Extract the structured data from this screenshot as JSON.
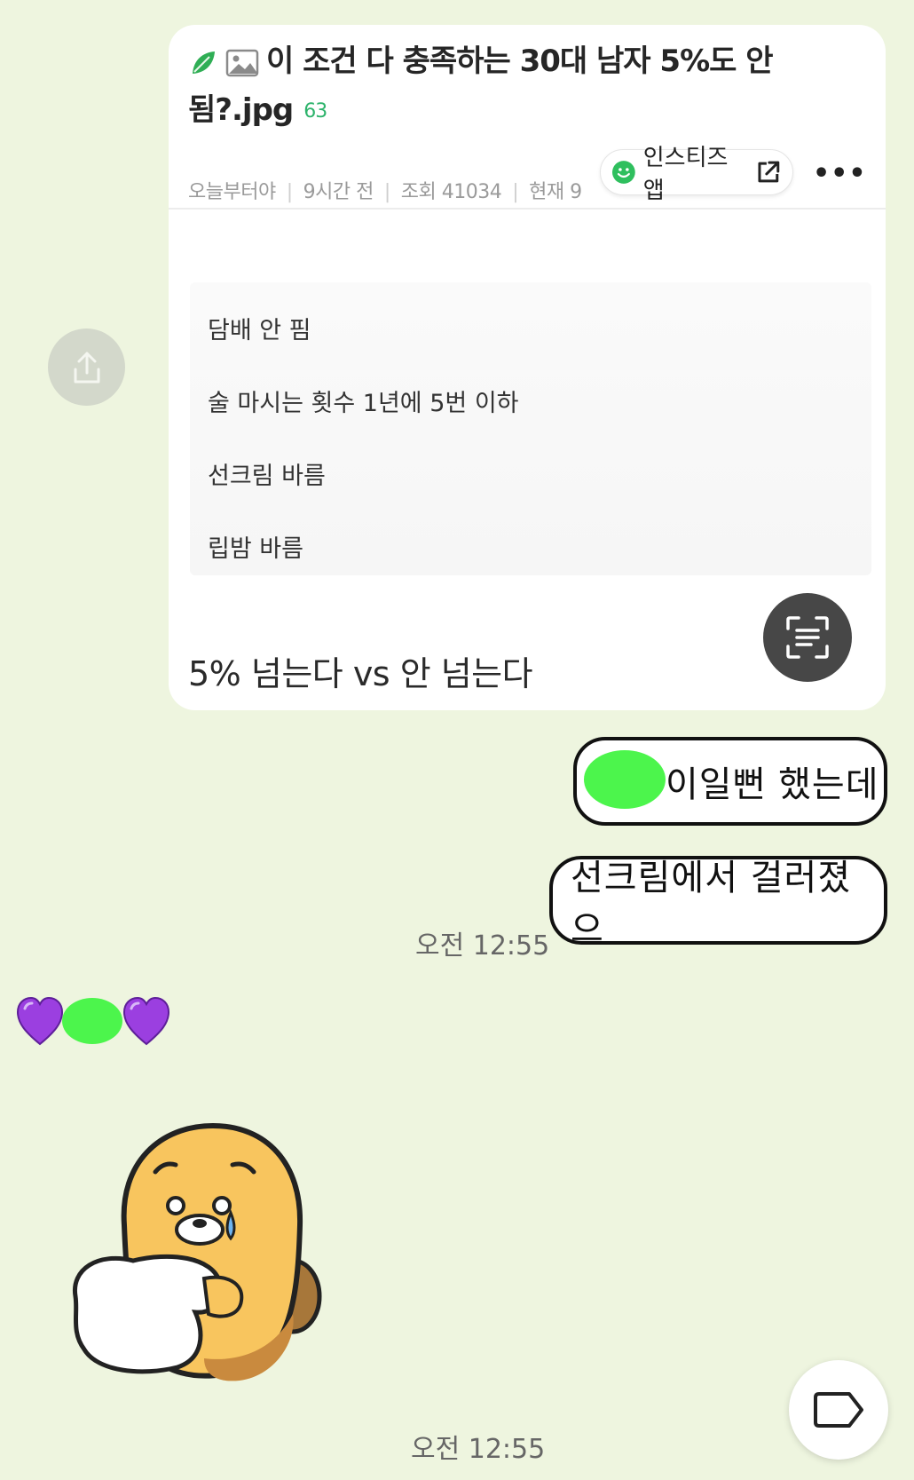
{
  "post": {
    "title": "이 조건 다 충족하는 30대 남자 5%도 안 됨?.jpg",
    "comment_count": "63",
    "author": "오늘부터야",
    "time_ago": "9시간 전",
    "views": "조회 41034",
    "current": "현재 9",
    "app_button": "인스티즈앱",
    "content_lines": [
      "담배 안 핌",
      "술 마시는 횟수 1년에 5번 이하",
      "선크림 바름",
      "립밤 바름"
    ],
    "caption": "5% 넘는다 vs 안 넘는다"
  },
  "messages": {
    "bubble1": "이일뻔 했는데",
    "bubble2": "선크림에서 걸러졌으",
    "time1": "오전 12:55",
    "time2": "오전 12:55"
  },
  "icons": {
    "leaf": "leaf-icon",
    "image": "image-icon",
    "share": "share-icon",
    "scan": "text-scan-icon",
    "more": "more-icon",
    "external": "external-link-icon",
    "tag": "tag-icon",
    "heart": "purple-heart-icon"
  },
  "colors": {
    "background": "#eef5df",
    "comment_count": "#2db36b",
    "blob": "#4cf54c",
    "heart": "#9b3fe0"
  }
}
